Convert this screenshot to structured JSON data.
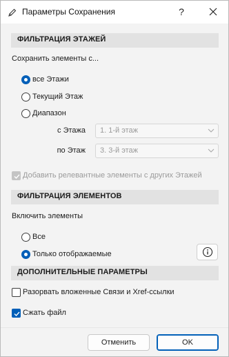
{
  "window": {
    "title": "Параметры Сохранения",
    "help_glyph": "?",
    "close_glyph": "✕",
    "app_icon": "pencil-icon"
  },
  "floor_filter": {
    "header": "ФИЛЬТРАЦИЯ ЭТАЖЕЙ",
    "prompt": "Сохранить элементы с...",
    "options": [
      "все Этажи",
      "Текущий Этаж",
      "Диапазон"
    ],
    "selected": "все Этажи",
    "from_label": "с Этажа",
    "from_value": "1. 1-й этаж",
    "to_label": "по Этаж",
    "to_value": "3. 3-й этаж",
    "relevant_label": "Добавить релевантные элементы с других Этажей",
    "relevant_checked": true,
    "relevant_disabled": true
  },
  "element_filter": {
    "header": "ФИЛЬТРАЦИЯ ЭЛЕМЕНТОВ",
    "prompt": "Включить элементы",
    "options": [
      "Все",
      "Только отображаемые"
    ],
    "selected": "Только отображаемые",
    "info_icon": "info-icon"
  },
  "extra": {
    "header": "ДОПОЛНИТЕЛЬНЫЕ ПАРАМЕТРЫ",
    "break_links_label": "Разорвать вложенные Связи и Xref-ссылки",
    "break_links_checked": false,
    "compress_label": "Сжать файл",
    "compress_checked": true
  },
  "buttons": {
    "cancel": "Отменить",
    "ok": "OK"
  },
  "colors": {
    "accent": "#005fb8",
    "section_bg": "#e2e2e2",
    "dialog_bg": "#f3f3f3"
  }
}
